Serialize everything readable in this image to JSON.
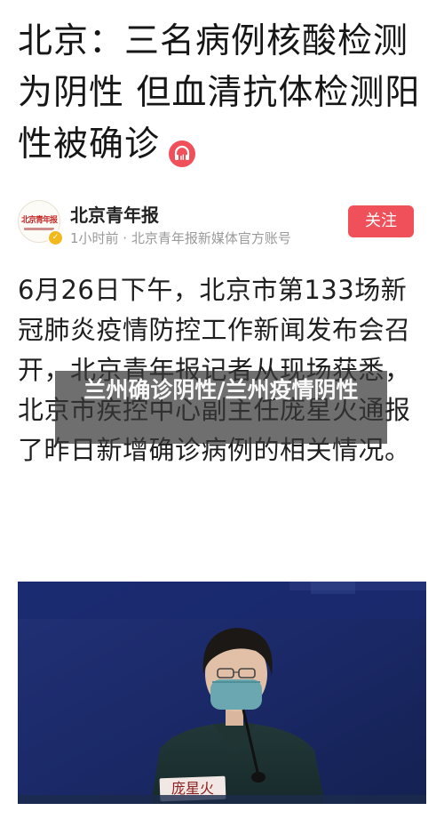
{
  "article": {
    "title": "北京：三名病例核酸检测为阴性 但血清抗体检测阳性被确诊",
    "audio_icon": "headphones-icon",
    "author": {
      "name": "北京青年报",
      "avatar_text": "北京青年报",
      "meta": "1小时前 · 北京青年报新媒体官方账号",
      "verified_icon": "check-icon",
      "follow_label": "关注"
    },
    "body": "6月26日下午，北京市第133场新冠肺炎疫情防控工作新闻发布会召开，北京青年报记者从现场获悉，北京市疾控中心副主任庞星火通报了昨日新增确诊病例的相关情况。",
    "photo": {
      "nameplate": "庞星火"
    }
  },
  "overlay": {
    "title": "兰州确诊阴性/兰州疫情阴性"
  },
  "colors": {
    "follow_button": "#f0505a",
    "audio_icon": "#f0505a",
    "photo_background": "#1d2a6f",
    "verified_badge": "#f2b81c"
  }
}
